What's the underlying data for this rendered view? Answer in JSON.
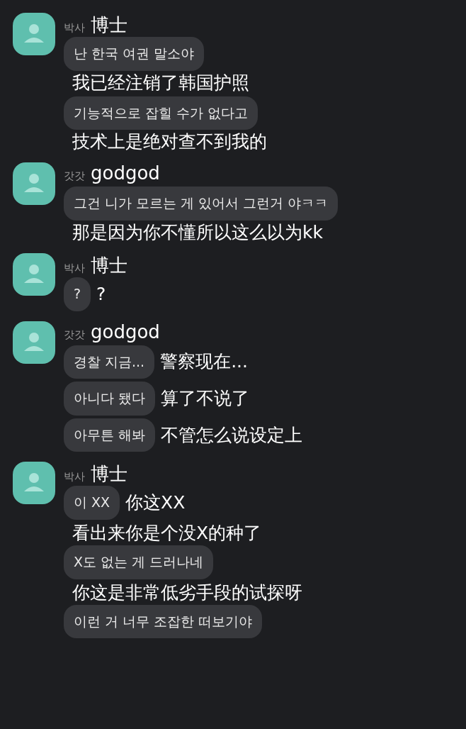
{
  "message_groups": [
    {
      "sender": "박사",
      "sender_translation": "博士",
      "messages": [
        {
          "text": "난 한국 여권 말소야",
          "translation": "我已经注销了韩国护照",
          "kind": "below"
        },
        {
          "text": "기능적으로 잡힐 수가 없다고",
          "translation": "技术上是绝对查不到我的",
          "kind": "below"
        }
      ]
    },
    {
      "sender": "갓갓",
      "sender_translation": "godgod",
      "messages": [
        {
          "text": "그건 니가 모르는 게 있어서 그런거 야ㅋㅋ",
          "translation": "那是因为你不懂所以这么以为kk",
          "kind": "below"
        }
      ]
    },
    {
      "sender": "박사",
      "sender_translation": "博士",
      "messages": [
        {
          "text": "?",
          "translation": "?",
          "kind": "right"
        }
      ]
    },
    {
      "sender": "갓갓",
      "sender_translation": "godgod",
      "messages": [
        {
          "text": "경찰 지금...",
          "translation": "警察现在...",
          "kind": "right"
        },
        {
          "text": "아니다 됐다",
          "translation": "算了不说了",
          "kind": "right"
        },
        {
          "text": "아무튼 해봐",
          "translation": "不管怎么说设定上",
          "kind": "right"
        }
      ]
    },
    {
      "sender": "박사",
      "sender_translation": "博士",
      "messages": [
        {
          "text": "이 XX",
          "translation": "你这XX",
          "kind": "right"
        },
        {
          "text": "X도 없는 게 드러나네",
          "translation": "看出来你是个没X的种了",
          "kind": "above"
        },
        {
          "text": "이런 거 너무 조잡한 떠보기야",
          "translation": "你这是非常低劣手段的试探呀",
          "kind": "above"
        }
      ]
    }
  ]
}
